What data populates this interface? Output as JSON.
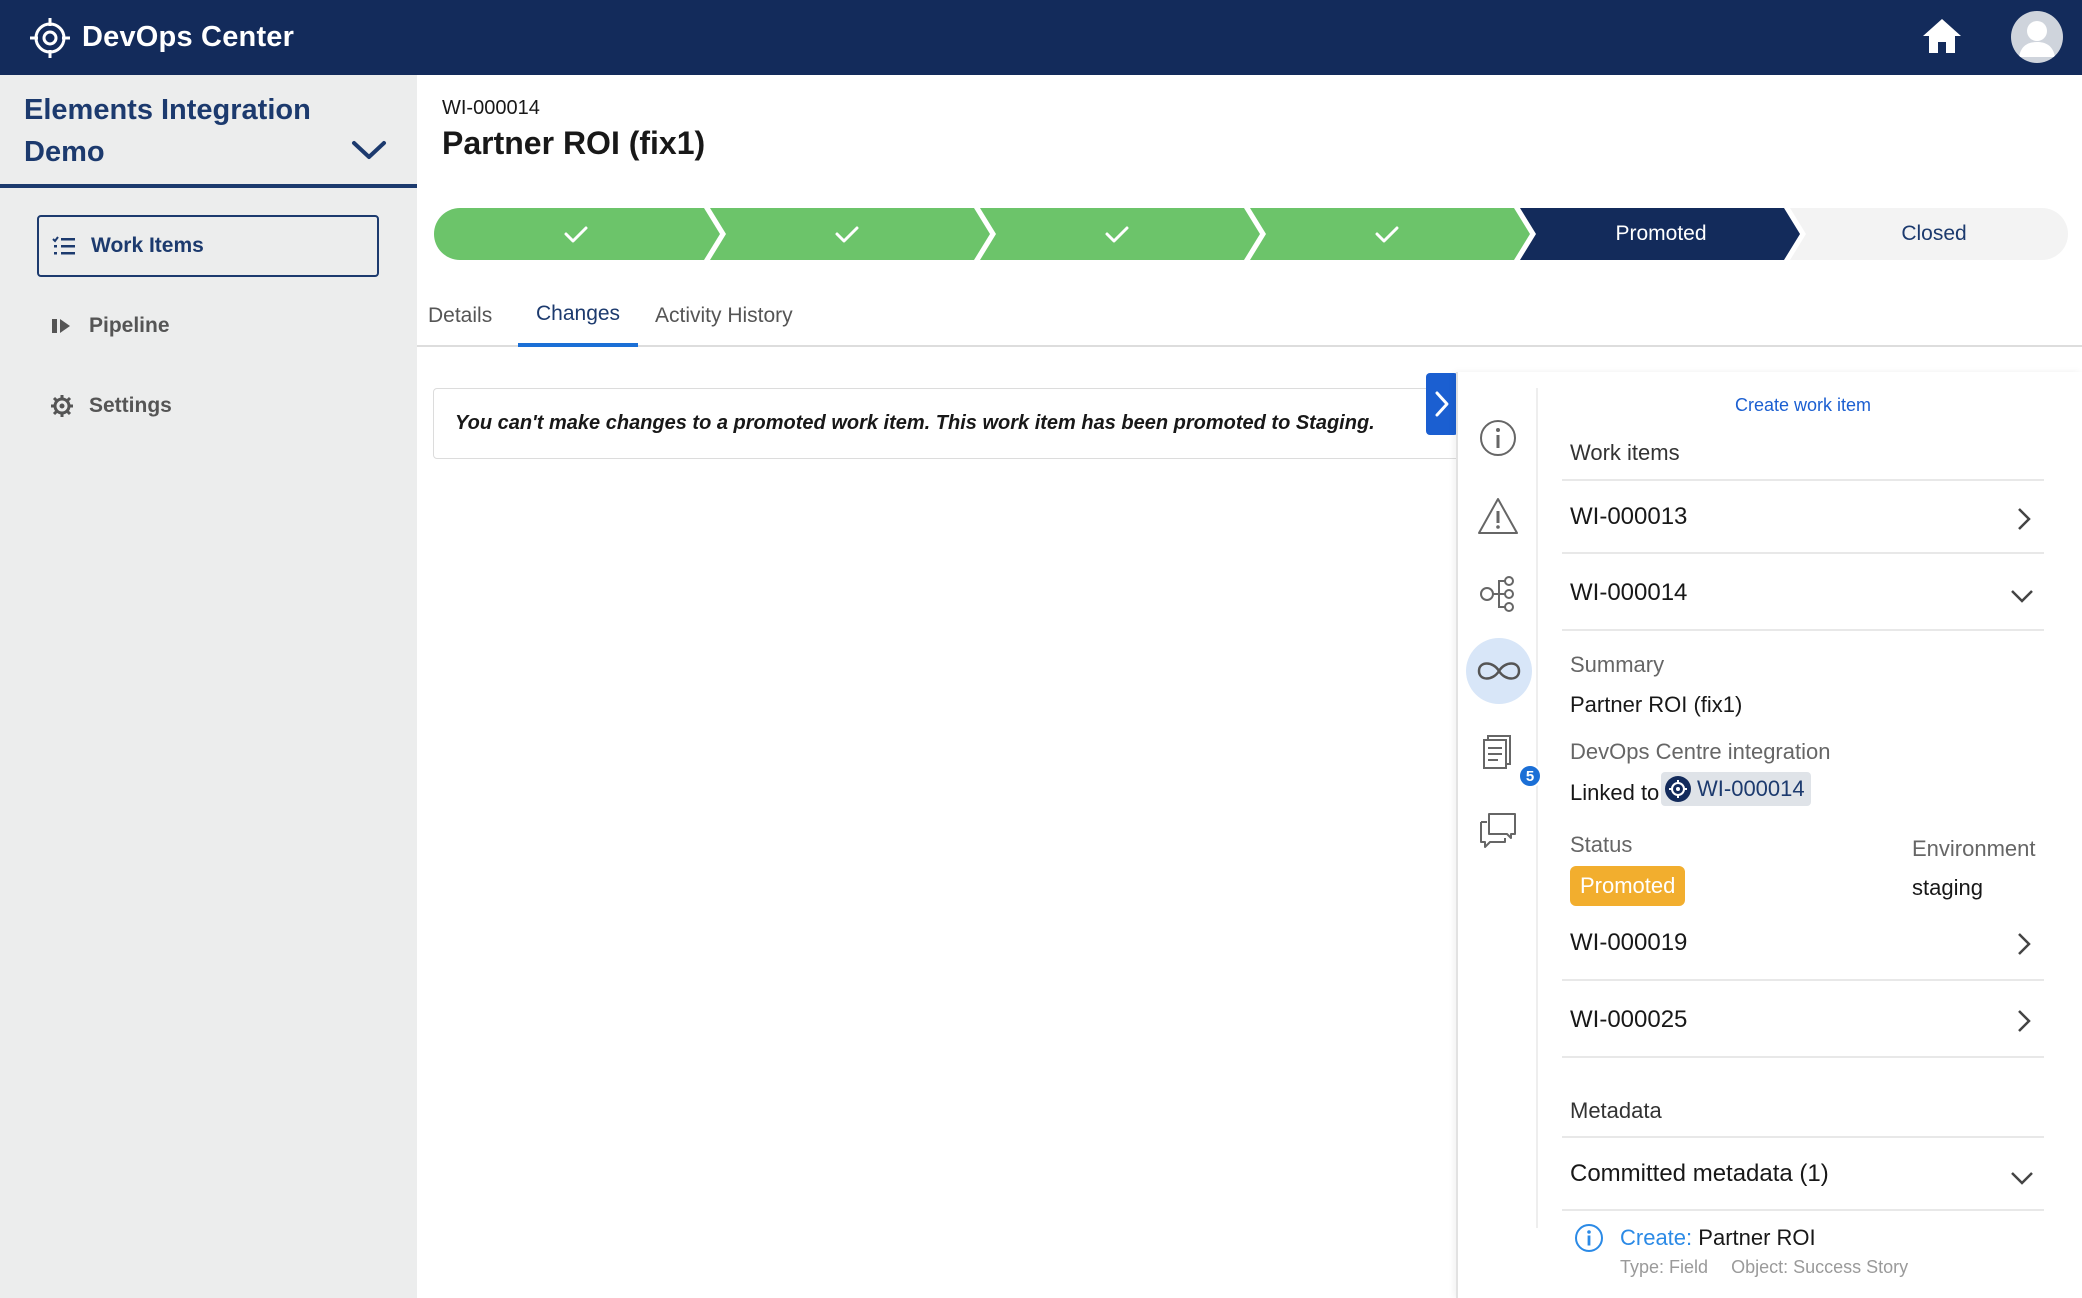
{
  "app": {
    "title": "DevOps Center"
  },
  "sidebar": {
    "project_name": "Elements Integration Demo",
    "items": [
      {
        "label": "Work Items"
      },
      {
        "label": "Pipeline"
      },
      {
        "label": "Settings"
      }
    ]
  },
  "work_item": {
    "id": "WI-000014",
    "title": "Partner ROI (fix1)"
  },
  "path": {
    "stages": [
      {
        "label": "",
        "state": "complete"
      },
      {
        "label": "",
        "state": "complete"
      },
      {
        "label": "",
        "state": "complete"
      },
      {
        "label": "",
        "state": "complete"
      },
      {
        "label": "Promoted",
        "state": "current"
      },
      {
        "label": "Closed",
        "state": "upcoming"
      }
    ],
    "colors": {
      "complete": "#6cc46a",
      "current": "#132b5b",
      "upcoming": "#f3f3f3"
    }
  },
  "tabs": [
    {
      "label": "Details"
    },
    {
      "label": "Changes"
    },
    {
      "label": "Activity History"
    }
  ],
  "notice": {
    "text": "You can't make changes to a promoted work item. This work item has been promoted to Staging."
  },
  "panel": {
    "create_link": "Create work item",
    "work_items_heading": "Work items",
    "rail_badge_count": "5",
    "rows": [
      {
        "label": "WI-000013"
      },
      {
        "label": "WI-000014"
      },
      {
        "label": "WI-000019"
      },
      {
        "label": "WI-000025"
      }
    ],
    "expanded": {
      "summary_label": "Summary",
      "summary_value": "Partner ROI (fix1)",
      "integration_label": "DevOps Centre integration",
      "linked_prefix": "Linked to",
      "linked_id": "WI-000014",
      "status_label": "Status",
      "status_value": "Promoted",
      "environment_label": "Environment",
      "environment_value": "staging"
    },
    "metadata_heading": "Metadata",
    "committed_label": "Committed metadata (1)",
    "metadata_item": {
      "action": "Create:",
      "name": "Partner ROI",
      "type_text": "Type: Field",
      "object_text": "Object: Success Story"
    }
  }
}
